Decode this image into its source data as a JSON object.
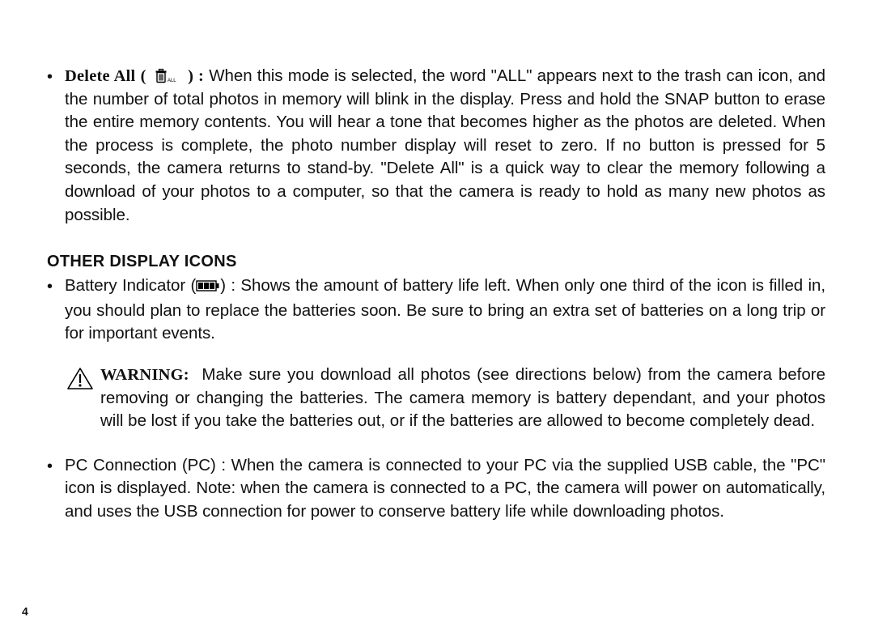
{
  "delete_all": {
    "label": "Delete All",
    "icon_name": "trash-all-icon",
    "text": "When this mode is selected, the word \"ALL\" appears next to the trash can icon, and the number of total photos in memory will blink in the display. Press and hold the SNAP button to erase the entire memory contents. You will hear a tone that becomes higher as the photos are deleted. When the process is complete, the photo number display will reset to zero. If no button is pressed for 5 seconds, the camera returns to stand-by. \"Delete All\" is a quick way to clear the memory following a download of your photos to a computer, so that the camera is ready to hold as many new photos as possible."
  },
  "section_heading": "OTHER DISPLAY ICONS",
  "battery": {
    "prefix": "Battery Indicator (",
    "suffix": ") : Shows the amount of battery life left. When only one third of the icon is filled in, you should plan to replace the batteries soon. Be sure to bring an extra set of batteries on a long trip or for important events."
  },
  "warning": {
    "label": "WARNING:",
    "text": "Make sure you download all photos (see directions below) from the camera before removing or changing the batteries. The camera memory is battery dependant, and your photos will be lost if you take the batteries out, or if the batteries are allowed to become completely dead."
  },
  "pc": {
    "text": "PC Connection (PC) : When the camera is connected to your PC via the supplied USB cable, the \"PC\" icon is displayed. Note: when the camera is connected to a PC, the camera will power on automatically, and uses the USB connection for power to conserve battery life while downloading photos."
  },
  "page_number": "4"
}
